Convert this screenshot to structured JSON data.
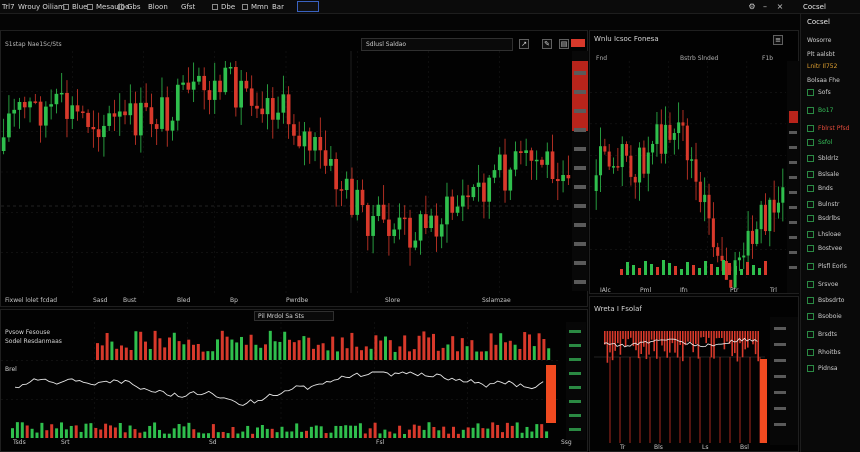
{
  "toolbar": {
    "items": [
      {
        "label": "Trl7"
      },
      {
        "label": "Wrouy Oiliam"
      },
      {
        "label": "Blue"
      },
      {
        "label": "Mesaulbo"
      },
      {
        "label": "Gbs"
      },
      {
        "label": "Bloon"
      },
      {
        "label": "Gfst"
      },
      {
        "label": "Dbe"
      },
      {
        "label": "Mmn"
      },
      {
        "label": "Bar"
      }
    ],
    "right_label": "Cocsel",
    "icons": [
      "settings-icon",
      "minimize-icon",
      "close-icon"
    ]
  },
  "main_chart": {
    "title": "S1stap Nae1Sc/Sts",
    "header_field": "Sdlusl Saldao",
    "footer_labels": [
      "Fixwel lolet fcdad",
      "Sasd",
      "Bust",
      "Bled",
      "Bp",
      "Pwrdbe",
      "Slore",
      "Sslamzae"
    ]
  },
  "right_chart": {
    "title": "Wnlu Icsoc Fonesa",
    "subtitle_labels": [
      "Fnd",
      "Bstrb Slnded",
      "F1b"
    ],
    "price_labels": [
      "Lk2",
      "Plt",
      "Pk"
    ],
    "footer_labels": [
      "IAlc",
      "Pml",
      "Ifn",
      "Ptr",
      "Trl"
    ]
  },
  "indicator_panel": {
    "header": "Pvsow Fesouse",
    "sub_header": "Sodel Resdanmaas",
    "line_label": "Brel",
    "tab_label": "Pil Mrdol Sa Sts",
    "footer_labels": [
      "Tsds",
      "Srt",
      "Sd",
      "Fsl",
      "Ssg"
    ]
  },
  "bottom_right_panel": {
    "header": "Wreta I Fsolaf",
    "footer_labels": [
      "Tr",
      "Bls",
      "Ls",
      "Bsl"
    ]
  },
  "sidebar": {
    "title": "Cocsel",
    "rows": [
      {
        "label": "Wosorre",
        "color": "#cfcfcf"
      },
      {
        "label": "Plt aalsbt",
        "color": "#cfcfcf"
      },
      {
        "label": "Lnitr Il752",
        "color": "#e0a030"
      },
      {
        "label": "Bolsaa Fhe",
        "color": "#cfcfcf"
      },
      {
        "label": "Sofs",
        "color": "#cfcfcf"
      },
      {
        "label": "Bo17",
        "color": "#36c05a"
      },
      {
        "label": "Fblrst Pfsd",
        "color": "#e04a3a"
      },
      {
        "label": "Ssfol",
        "color": "#36c05a"
      },
      {
        "label": "Sbldrlz",
        "color": "#cfcfcf"
      },
      {
        "label": "Bslsale",
        "color": "#cfcfcf"
      },
      {
        "label": "Bnds",
        "color": "#cfcfcf"
      },
      {
        "label": "Bulnstr",
        "color": "#cfcfcf"
      },
      {
        "label": "Bsdrlbs",
        "color": "#cfcfcf"
      },
      {
        "label": "Lhsloae",
        "color": "#cfcfcf"
      },
      {
        "label": "Bostvee",
        "color": "#cfcfcf"
      },
      {
        "label": "Plsfl Eorls",
        "color": "#cfcfcf"
      },
      {
        "label": "Srsvoe",
        "color": "#cfcfcf"
      },
      {
        "label": "Bsbsdrto",
        "color": "#cfcfcf"
      },
      {
        "label": "Bsoboie",
        "color": "#cfcfcf"
      },
      {
        "label": "Brsdts",
        "color": "#cfcfcf"
      },
      {
        "label": "Rhoitbs",
        "color": "#cfcfcf"
      },
      {
        "label": "Pidnsa",
        "color": "#cfcfcf"
      }
    ]
  },
  "colors": {
    "up": "#2fbf4d",
    "down": "#d8392b",
    "accent": "#3a62c0",
    "highlight": "#f04a20"
  }
}
